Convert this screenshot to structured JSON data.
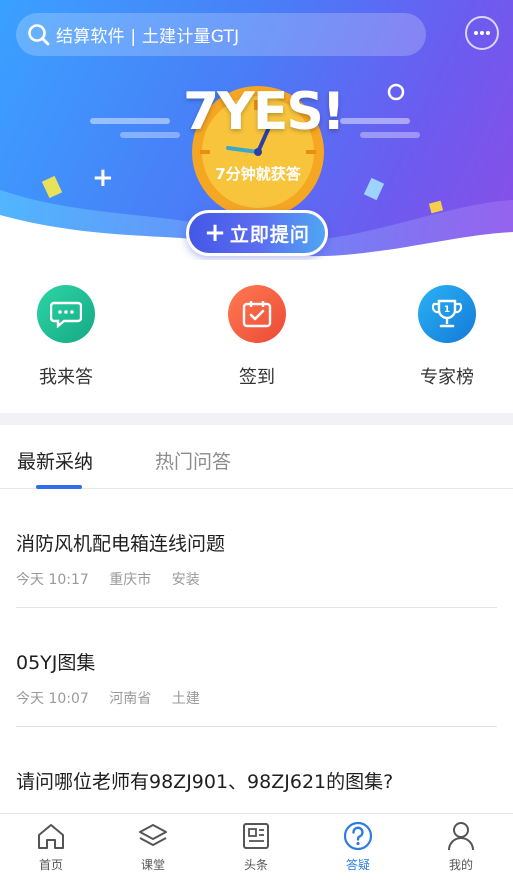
{
  "search": {
    "placeholder": "结算软件 | 土建计量GTJ"
  },
  "promo": {
    "title": "7YES!",
    "subtitle": "7分钟就获答"
  },
  "ask_button": {
    "label": "立即提问"
  },
  "quick_actions": [
    {
      "label": "我来答",
      "color": "#1fbf95"
    },
    {
      "label": "签到",
      "color": "#f25a43"
    },
    {
      "label": "专家榜",
      "color": "#1c8fe6"
    }
  ],
  "tabs": [
    {
      "label": "最新采纳",
      "active": true
    },
    {
      "label": "热门问答",
      "active": false
    }
  ],
  "questions": [
    {
      "title": "消防风机配电箱连线问题",
      "time": "今天 10:17",
      "region": "重庆市",
      "category": "安装"
    },
    {
      "title": "05YJ图集",
      "time": "今天 10:07",
      "region": "河南省",
      "category": "土建"
    },
    {
      "title": "请问哪位老师有98ZJ901、98ZJ621的图集?",
      "time": "",
      "region": "",
      "category": ""
    }
  ],
  "bottom_nav": [
    {
      "label": "首页",
      "icon": "home-icon",
      "active": false
    },
    {
      "label": "课堂",
      "icon": "layers-icon",
      "active": false
    },
    {
      "label": "头条",
      "icon": "news-icon",
      "active": false
    },
    {
      "label": "答疑",
      "icon": "question-icon",
      "active": true
    },
    {
      "label": "我的",
      "icon": "user-icon",
      "active": false
    }
  ],
  "colors": {
    "accent": "#2f6fe8",
    "nav_active": "#2f7de1"
  }
}
